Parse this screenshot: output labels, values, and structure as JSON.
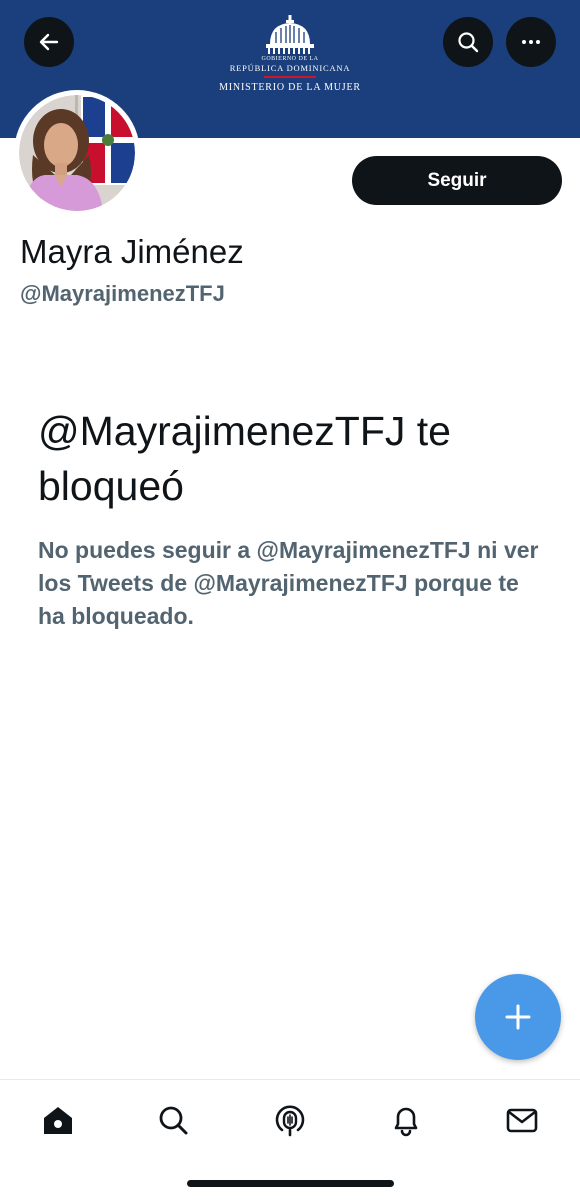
{
  "banner": {
    "logo": {
      "line1": "GOBIERNO DE LA",
      "line2": "REPÚBLICA DOMINICANA",
      "line3": "MINISTERIO DE LA MUJER"
    }
  },
  "profile": {
    "display_name": "Mayra Jiménez",
    "handle": "@MayrajimenezTFJ",
    "follow_label": "Seguir"
  },
  "blocked": {
    "title": "@MayrajimenezTFJ te bloqueó",
    "body": "No puedes seguir a @MayrajimenezTFJ ni ver los Tweets de @MayrajimenezTFJ porque te ha bloqueado."
  },
  "icons": {
    "back": "arrow-left-icon",
    "search": "search-icon",
    "more": "more-horizontal-icon",
    "compose": "plus-icon",
    "nav": [
      "home-icon",
      "search-icon",
      "spaces-icon",
      "notifications-icon",
      "messages-icon"
    ]
  },
  "colors": {
    "banner": "#1a3f7c",
    "primary_text": "#0f1419",
    "secondary_text": "#536471",
    "accent": "#4a99e9"
  }
}
